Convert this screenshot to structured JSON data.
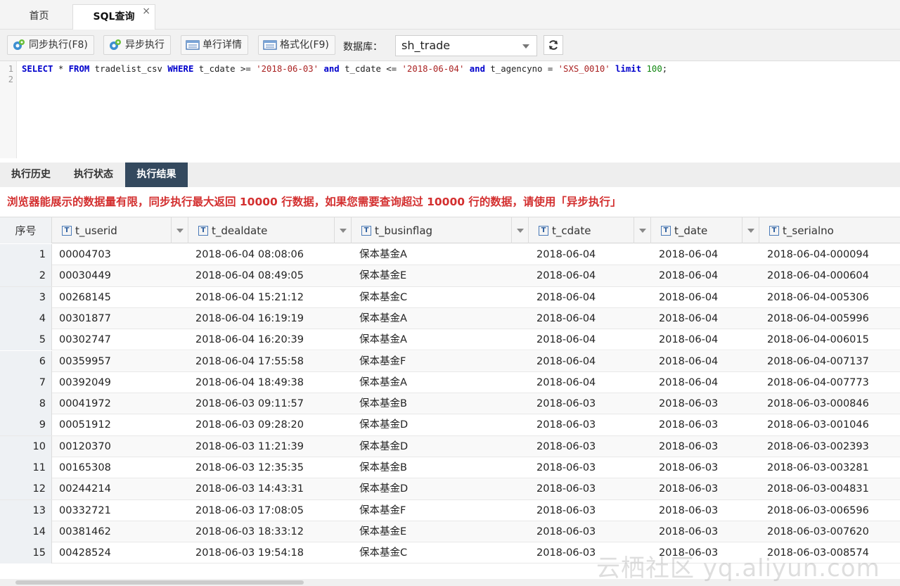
{
  "tabs": {
    "home": "首页",
    "sql": "SQL查询",
    "close": "×"
  },
  "toolbar": {
    "sync_exec": "同步执行(F8)",
    "async_exec": "异步执行",
    "row_detail": "单行详情",
    "format": "格式化(F9)",
    "db_label": "数据库：",
    "db_value": "sh_trade"
  },
  "editor": {
    "line_numbers": [
      "1",
      "2"
    ],
    "sql": {
      "t1": "SELECT",
      "t2": " * ",
      "t3": "FROM",
      "t4": " tradelist_csv ",
      "t5": "WHERE",
      "t6": " t_cdate >= ",
      "t7": "'2018-06-03'",
      "t8": " ",
      "t9": "and",
      "t10": " t_cdate <= ",
      "t11": "'2018-06-04'",
      "t12": " ",
      "t13": "and",
      "t14": " t_agencyno = ",
      "t15": "'SXS_0010'",
      "t16": " ",
      "t17": "limit",
      "t18": " ",
      "t19": "100",
      "t20": ";"
    }
  },
  "result_tabs": [
    "执行历史",
    "执行状态",
    "执行结果"
  ],
  "warning": "浏览器能展示的数据量有限，同步执行最大返回 10000 行数据，如果您需要查询超过 10000 行的数据，请使用「异步执行」",
  "table": {
    "index_header": "序号",
    "columns": [
      "t_userid",
      "t_dealdate",
      "t_businflag",
      "t_cdate",
      "t_date",
      "t_serialno"
    ],
    "rows": [
      [
        "1",
        "00004703",
        "2018-06-04 08:08:06",
        "保本基金A",
        "2018-06-04",
        "2018-06-04",
        "2018-06-04-000094"
      ],
      [
        "2",
        "00030449",
        "2018-06-04 08:49:05",
        "保本基金E",
        "2018-06-04",
        "2018-06-04",
        "2018-06-04-000604"
      ],
      [
        "3",
        "00268145",
        "2018-06-04 15:21:12",
        "保本基金C",
        "2018-06-04",
        "2018-06-04",
        "2018-06-04-005306"
      ],
      [
        "4",
        "00301877",
        "2018-06-04 16:19:19",
        "保本基金A",
        "2018-06-04",
        "2018-06-04",
        "2018-06-04-005996"
      ],
      [
        "5",
        "00302747",
        "2018-06-04 16:20:39",
        "保本基金A",
        "2018-06-04",
        "2018-06-04",
        "2018-06-04-006015"
      ],
      [
        "6",
        "00359957",
        "2018-06-04 17:55:58",
        "保本基金F",
        "2018-06-04",
        "2018-06-04",
        "2018-06-04-007137"
      ],
      [
        "7",
        "00392049",
        "2018-06-04 18:49:38",
        "保本基金A",
        "2018-06-04",
        "2018-06-04",
        "2018-06-04-007773"
      ],
      [
        "8",
        "00041972",
        "2018-06-03 09:11:57",
        "保本基金B",
        "2018-06-03",
        "2018-06-03",
        "2018-06-03-000846"
      ],
      [
        "9",
        "00051912",
        "2018-06-03 09:28:20",
        "保本基金D",
        "2018-06-03",
        "2018-06-03",
        "2018-06-03-001046"
      ],
      [
        "10",
        "00120370",
        "2018-06-03 11:21:39",
        "保本基金D",
        "2018-06-03",
        "2018-06-03",
        "2018-06-03-002393"
      ],
      [
        "11",
        "00165308",
        "2018-06-03 12:35:35",
        "保本基金B",
        "2018-06-03",
        "2018-06-03",
        "2018-06-03-003281"
      ],
      [
        "12",
        "00244214",
        "2018-06-03 14:43:31",
        "保本基金D",
        "2018-06-03",
        "2018-06-03",
        "2018-06-03-004831"
      ],
      [
        "13",
        "00332721",
        "2018-06-03 17:08:05",
        "保本基金F",
        "2018-06-03",
        "2018-06-03",
        "2018-06-03-006596"
      ],
      [
        "14",
        "00381462",
        "2018-06-03 18:33:12",
        "保本基金E",
        "2018-06-03",
        "2018-06-03",
        "2018-06-03-007620"
      ],
      [
        "15",
        "00428524",
        "2018-06-03 19:54:18",
        "保本基金C",
        "2018-06-03",
        "2018-06-03",
        "2018-06-03-008574"
      ]
    ]
  },
  "watermark": "云栖社区 yq.aliyun.com",
  "icons": {
    "sync": "execute-icon",
    "async": "execute-icon",
    "row_detail": "table-icon",
    "format": "table-icon",
    "refresh": "refresh-icon",
    "column_type": "text-type-icon"
  },
  "colors": {
    "keyword": "#0000cc",
    "string": "#aa2222",
    "number": "#118811",
    "warning": "#d32f2f",
    "active_tab": "#34495e"
  }
}
